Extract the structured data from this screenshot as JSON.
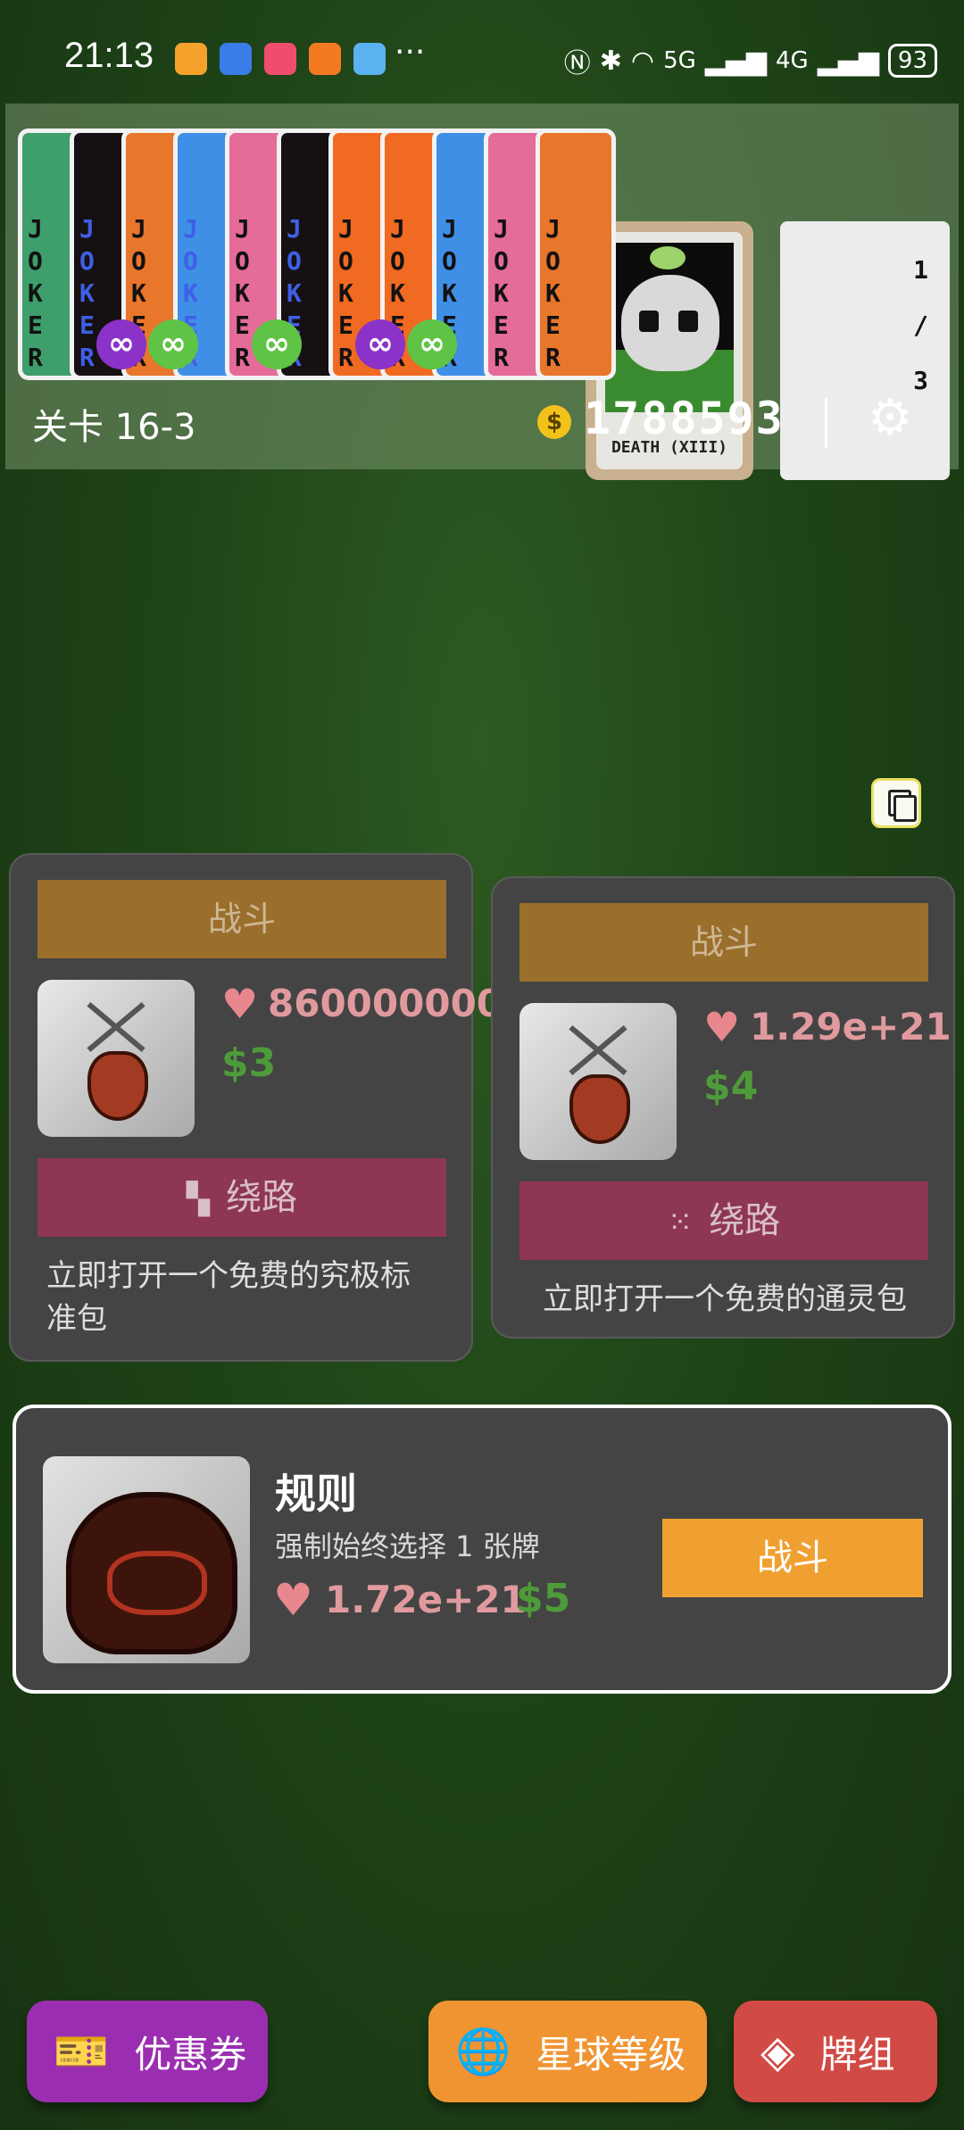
{
  "status_bar": {
    "time": "21:13",
    "battery": "93",
    "network_labels": [
      "5G",
      "4G"
    ]
  },
  "jokers": {
    "card_text": "JOKER",
    "card_colors": [
      "#3e9e6c",
      "#151012",
      "#e8762b",
      "#3f8fe6",
      "#e56b98",
      "#151012",
      "#f06a21",
      "#f06a21",
      "#3f8fe6",
      "#e56b98",
      "#e8762b"
    ],
    "card_text_colors": [
      "#111",
      "#3f5fe6",
      "#111",
      "#3f5fe6",
      "#111",
      "#3f5fe6",
      "#111",
      "#111",
      "#111",
      "#111",
      "#111"
    ],
    "infinity_badges": [
      {
        "symbol": "∞",
        "color": "purple"
      },
      {
        "symbol": "∞",
        "color": "green"
      },
      {
        "symbol": "∞",
        "color": "green"
      },
      {
        "symbol": "∞",
        "color": "purple"
      },
      {
        "symbol": "∞",
        "color": "green"
      }
    ],
    "consumable_name": "DEATH (XIII)",
    "counter": {
      "current": "1",
      "sep": "/",
      "total": "3"
    }
  },
  "header": {
    "level": "关卡 16-3",
    "money_icon": "$",
    "money": "1788593",
    "settings_icon": "gear-icon"
  },
  "small_blind": {
    "fight_label": "战斗",
    "hp": "860000000",
    "reward": "$3",
    "skip_label": "绕路",
    "skip_icon": "▚",
    "description": "立即打开一个免费的究极标准包"
  },
  "big_blind": {
    "fight_label": "战斗",
    "hp": "1.29e+21",
    "reward": "$4",
    "skip_label": "绕路",
    "skip_icon": "⁙",
    "description": "立即打开一个免费的通灵包"
  },
  "boss_blind": {
    "name": "规则",
    "effect": "强制始终选择 1 张牌",
    "hp": "1.72e+21",
    "reward": "$5",
    "fight_label": "战斗"
  },
  "bottom_nav": {
    "coupons": "优惠券",
    "planet_levels": "星球等级",
    "deck": "牌组"
  },
  "colors": {
    "background": "#1f4418",
    "fight": "#f0a031",
    "skip": "#8e3656",
    "hp": "#e09a9e",
    "reward": "#4e9b3a"
  }
}
